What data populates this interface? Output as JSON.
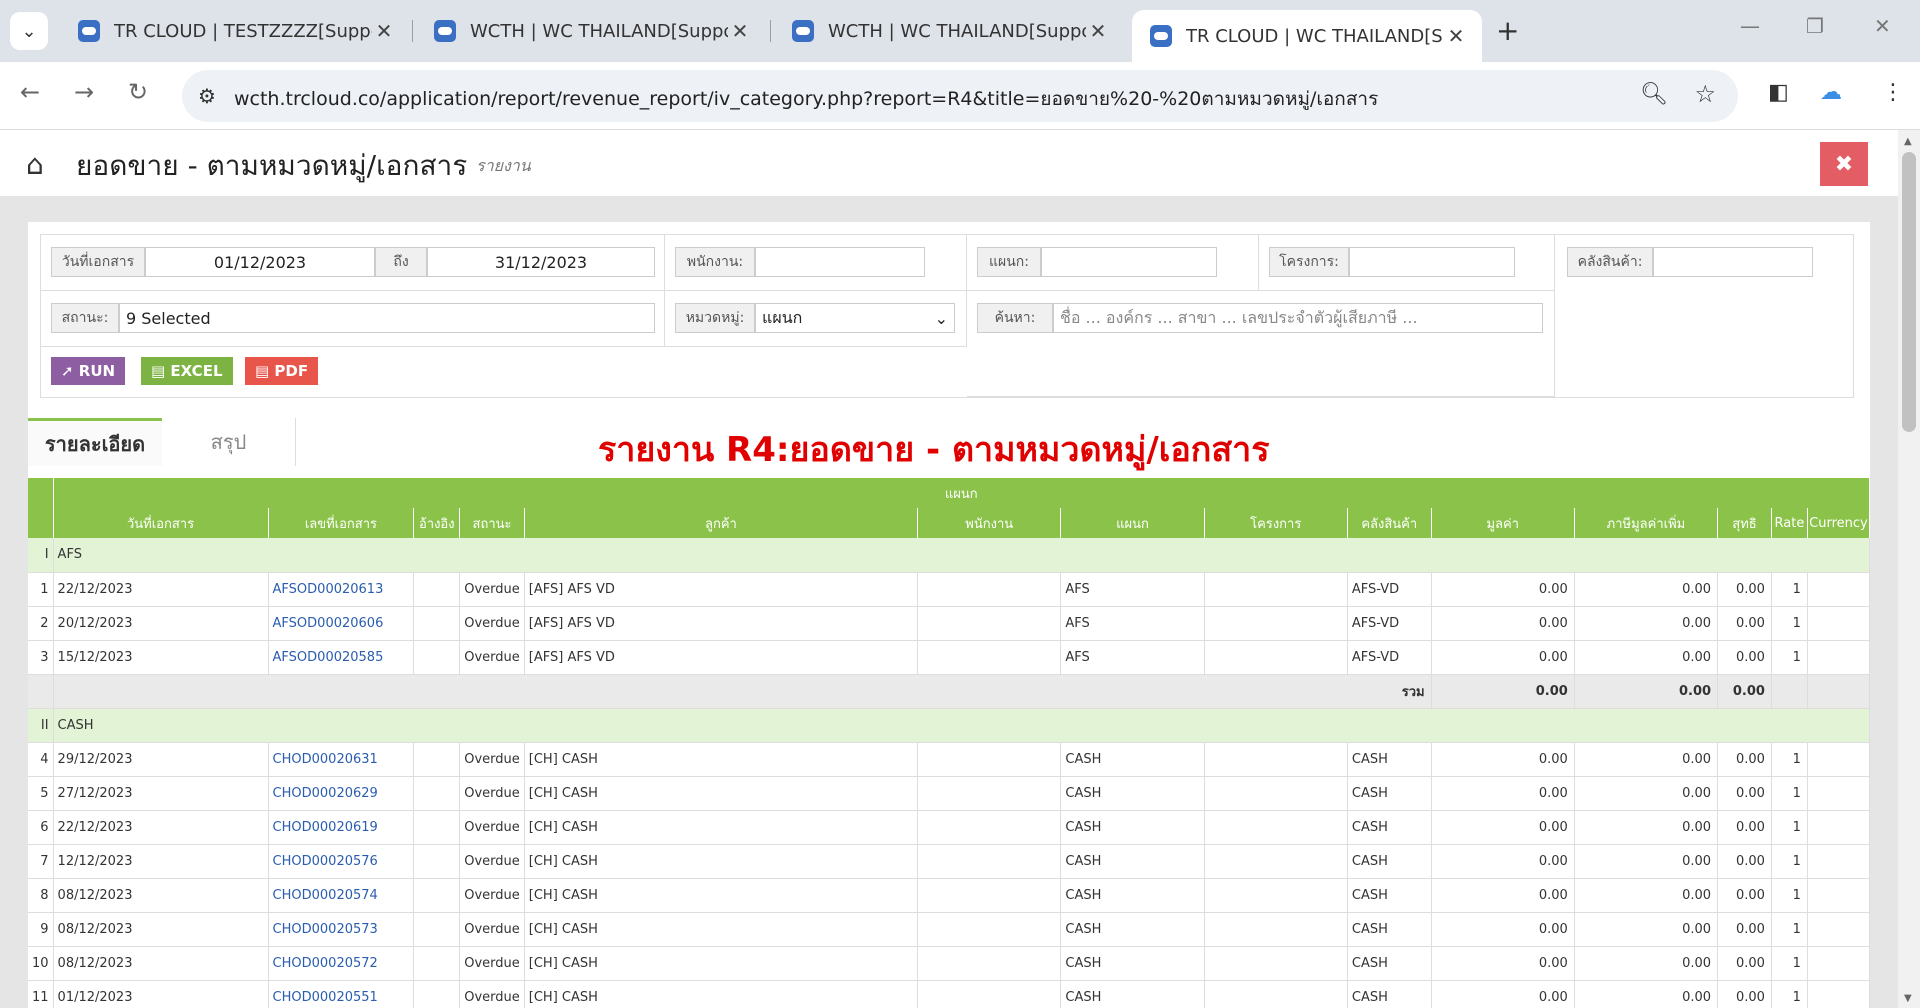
{
  "browser": {
    "tabs": [
      {
        "title": "TR CLOUD | TESTZZZZ[Support]"
      },
      {
        "title": "WCTH | WC THAILAND[Support]"
      },
      {
        "title": "WCTH | WC THAILAND[Support]"
      },
      {
        "title": "TR CLOUD | WC THAILAND[Support]"
      }
    ],
    "url": "wcth.trcloud.co/application/report/revenue_report/iv_category.php?report=R4&title=ยอดขาย%20-%20ตามหมวดหมู่/เอกสาร"
  },
  "header": {
    "title": "ยอดขาย - ตามหมวดหมู่/เอกสาร",
    "subtitle": "รายงาน"
  },
  "filters": {
    "date_label": "วันที่เอกสาร",
    "date_from": "01/12/2023",
    "to_label": "ถึง",
    "date_to": "31/12/2023",
    "employee_label": "พนักงาน:",
    "department_label": "แผนก:",
    "project_label": "โครงการ:",
    "warehouse_label": "คลังสินค้า:",
    "status_label": "สถานะ:",
    "status_value": "9 Selected",
    "category_label": "หมวดหมู่:",
    "category_value": "แผนก",
    "search_label": "ค้นหา:",
    "search_placeholder": "ชื่อ ... องค์กร ... สาขา ... เลขประจำตัวผู้เสียภาษี ...",
    "run": "RUN",
    "excel": "EXCEL",
    "pdf": "PDF"
  },
  "view_tabs": {
    "detail": "รายละเอียด",
    "summary": "สรุป"
  },
  "report_title": "รายงาน R4:ยอดขาย - ตามหมวดหมู่/เอกสาร",
  "table": {
    "group_header": "แผนก",
    "columns": [
      "วันที่เอกสาร",
      "เลขที่เอกสาร",
      "อ้างอิง",
      "สถานะ",
      "ลูกค้า",
      "พนักงาน",
      "แผนก",
      "โครงการ",
      "คลังสินค้า",
      "มูลค่า",
      "ภาษีมูลค่าเพิ่ม",
      "สุทธิ",
      "Rate",
      "Currency"
    ],
    "groups": [
      {
        "no": "I",
        "name": "AFS",
        "rows": [
          {
            "n": "1",
            "date": "22/12/2023",
            "doc": "AFSOD00020613",
            "status": "Overdue",
            "cust": "[AFS] AFS VD",
            "dept": "AFS",
            "wh": "AFS-VD",
            "val": "0.00",
            "vat": "0.00",
            "net": "0.00",
            "rate": "1"
          },
          {
            "n": "2",
            "date": "20/12/2023",
            "doc": "AFSOD00020606",
            "status": "Overdue",
            "cust": "[AFS] AFS VD",
            "dept": "AFS",
            "wh": "AFS-VD",
            "val": "0.00",
            "vat": "0.00",
            "net": "0.00",
            "rate": "1"
          },
          {
            "n": "3",
            "date": "15/12/2023",
            "doc": "AFSOD00020585",
            "status": "Overdue",
            "cust": "[AFS] AFS VD",
            "dept": "AFS",
            "wh": "AFS-VD",
            "val": "0.00",
            "vat": "0.00",
            "net": "0.00",
            "rate": "1"
          }
        ],
        "total_label": "รวม",
        "total_val": "0.00",
        "total_vat": "0.00",
        "total_net": "0.00"
      },
      {
        "no": "II",
        "name": "CASH",
        "rows": [
          {
            "n": "4",
            "date": "29/12/2023",
            "doc": "CHOD00020631",
            "status": "Overdue",
            "cust": "[CH] CASH",
            "dept": "CASH",
            "wh": "CASH",
            "val": "0.00",
            "vat": "0.00",
            "net": "0.00",
            "rate": "1"
          },
          {
            "n": "5",
            "date": "27/12/2023",
            "doc": "CHOD00020629",
            "status": "Overdue",
            "cust": "[CH] CASH",
            "dept": "CASH",
            "wh": "CASH",
            "val": "0.00",
            "vat": "0.00",
            "net": "0.00",
            "rate": "1"
          },
          {
            "n": "6",
            "date": "22/12/2023",
            "doc": "CHOD00020619",
            "status": "Overdue",
            "cust": "[CH] CASH",
            "dept": "CASH",
            "wh": "CASH",
            "val": "0.00",
            "vat": "0.00",
            "net": "0.00",
            "rate": "1"
          },
          {
            "n": "7",
            "date": "12/12/2023",
            "doc": "CHOD00020576",
            "status": "Overdue",
            "cust": "[CH] CASH",
            "dept": "CASH",
            "wh": "CASH",
            "val": "0.00",
            "vat": "0.00",
            "net": "0.00",
            "rate": "1"
          },
          {
            "n": "8",
            "date": "08/12/2023",
            "doc": "CHOD00020574",
            "status": "Overdue",
            "cust": "[CH] CASH",
            "dept": "CASH",
            "wh": "CASH",
            "val": "0.00",
            "vat": "0.00",
            "net": "0.00",
            "rate": "1"
          },
          {
            "n": "9",
            "date": "08/12/2023",
            "doc": "CHOD00020573",
            "status": "Overdue",
            "cust": "[CH] CASH",
            "dept": "CASH",
            "wh": "CASH",
            "val": "0.00",
            "vat": "0.00",
            "net": "0.00",
            "rate": "1"
          },
          {
            "n": "10",
            "date": "08/12/2023",
            "doc": "CHOD00020572",
            "status": "Overdue",
            "cust": "[CH] CASH",
            "dept": "CASH",
            "wh": "CASH",
            "val": "0.00",
            "vat": "0.00",
            "net": "0.00",
            "rate": "1"
          },
          {
            "n": "11",
            "date": "01/12/2023",
            "doc": "CHOD00020551",
            "status": "Overdue",
            "cust": "[CH] CASH",
            "dept": "CASH",
            "wh": "CASH",
            "val": "0.00",
            "vat": "0.00",
            "net": "0.00",
            "rate": "1"
          }
        ]
      }
    ]
  },
  "colors": {
    "accent": "#8bc34a",
    "run": "#8e5ea2",
    "excel": "#7cb342",
    "pdf": "#e8554a",
    "close": "#e35d65",
    "title_red": "#e00000"
  }
}
